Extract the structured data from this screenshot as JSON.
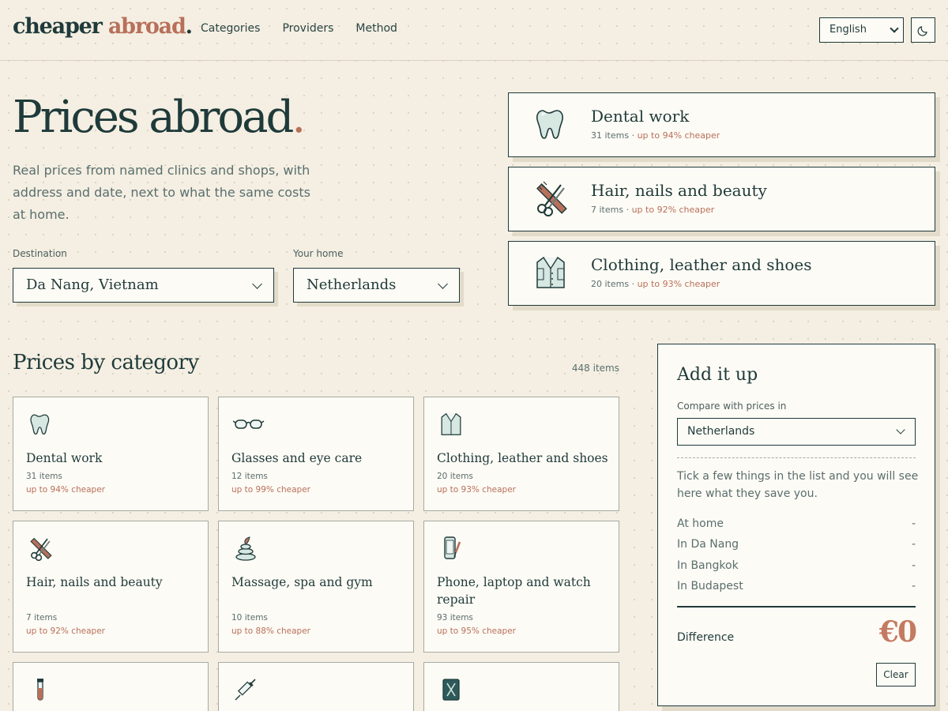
{
  "header": {
    "logo_main": "cheaper",
    "logo_accent": "abroad",
    "logo_dot": ".",
    "nav": [
      "Categories",
      "Providers",
      "Method"
    ],
    "language": "English"
  },
  "hero": {
    "title": "Prices abroad",
    "title_dot": ".",
    "subtitle": "Real prices from named clinics and shops, with address and date, next to what the same costs at home.",
    "destination_label": "Destination",
    "destination_value": "Da Nang, Vietnam",
    "home_label": "Your home",
    "home_value": "Netherlands"
  },
  "featured": [
    {
      "title": "Dental work",
      "count": "31 items",
      "sep": " · ",
      "cheaper": "up to 94% cheaper",
      "icon": "tooth-icon"
    },
    {
      "title": "Hair, nails and beauty",
      "count": "7 items",
      "sep": " · ",
      "cheaper": "up to 92% cheaper",
      "icon": "scissors-comb-icon"
    },
    {
      "title": "Clothing, leather and shoes",
      "count": "20 items",
      "sep": " · ",
      "cheaper": "up to 93% cheaper",
      "icon": "shirt-icon"
    }
  ],
  "categories_section": {
    "title": "Prices by category",
    "count": "448 items",
    "cards": [
      {
        "title": "Dental work",
        "count": "31 items",
        "cheaper": "up to 94% cheaper",
        "icon": "tooth-icon"
      },
      {
        "title": "Glasses and eye care",
        "count": "12 items",
        "cheaper": "up to 99% cheaper",
        "icon": "glasses-icon"
      },
      {
        "title": "Clothing, leather and shoes",
        "count": "20 items",
        "cheaper": "up to 93% cheaper",
        "icon": "shirt-icon"
      },
      {
        "title": "Hair, nails and beauty",
        "count": "7 items",
        "cheaper": "up to 92% cheaper",
        "icon": "scissors-comb-icon"
      },
      {
        "title": "Massage, spa and gym",
        "count": "10 items",
        "cheaper": "up to 88% cheaper",
        "icon": "spa-stones-icon"
      },
      {
        "title": "Phone, laptop and watch repair",
        "count": "93 items",
        "cheaper": "up to 95% cheaper",
        "icon": "phone-repair-icon"
      },
      {
        "icon": "test-tube-icon"
      },
      {
        "icon": "syringe-icon"
      },
      {
        "icon": "document-icon"
      }
    ]
  },
  "panel": {
    "title": "Add it up",
    "compare_label": "Compare with prices in",
    "compare_value": "Netherlands",
    "hint": "Tick a few things in the list and you will see here what they save you.",
    "rows": [
      {
        "label": "At home",
        "value": "-"
      },
      {
        "label": "In Da Nang",
        "value": "-"
      },
      {
        "label": "In Bangkok",
        "value": "-"
      },
      {
        "label": "In Budapest",
        "value": "-"
      }
    ],
    "difference_label": "Difference",
    "difference_value": "€0",
    "clear_label": "Clear"
  },
  "colors": {
    "background": "#f4efe2",
    "ink": "#1f3a3a",
    "accent": "#b8705a",
    "card": "#fdfbf5"
  }
}
